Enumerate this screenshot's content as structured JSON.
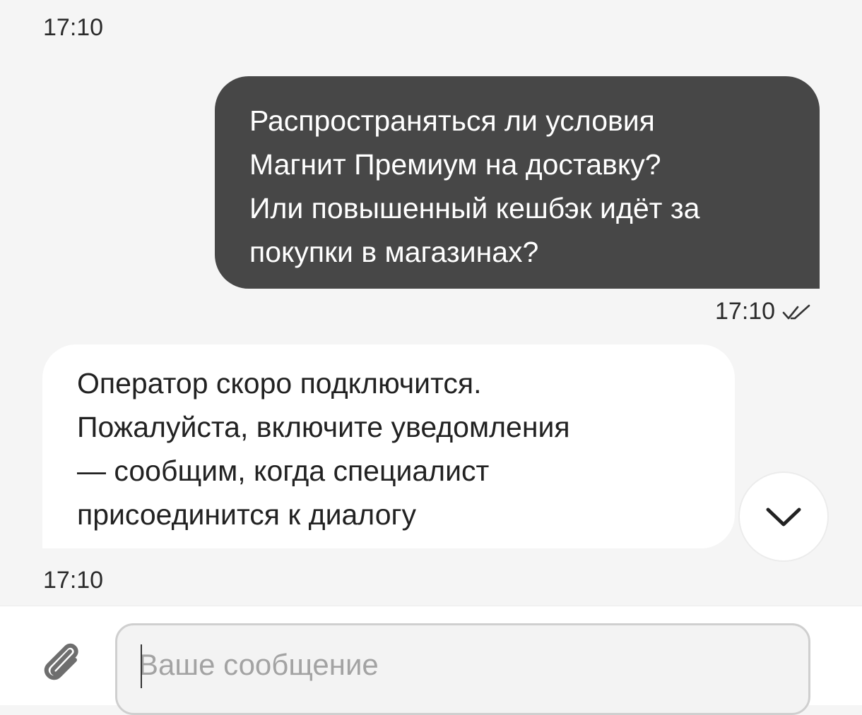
{
  "chat": {
    "timestamp_top": "17:10",
    "outgoing": {
      "text": "Распространяться ли условия\nМагнит Премиум на доставку?\nИли повышенный кешбэк идёт за\nпокупки в магазинах?",
      "time": "17:10",
      "status_icon": "double-check-icon"
    },
    "incoming": {
      "text": "Оператор скоро подключится.\nПожалуйста, включите уведомления\n— сообщим, когда специалист\nприсоединится к диалогу",
      "time": "17:10"
    },
    "scroll_button_icon": "chevron-down-icon"
  },
  "composer": {
    "attach_icon": "paperclip-icon",
    "placeholder": "Ваше сообщение",
    "value": ""
  },
  "colors": {
    "background": "#f5f5f5",
    "outgoing_bubble": "#474747",
    "incoming_bubble": "#ffffff",
    "placeholder": "#a3a3a3"
  }
}
